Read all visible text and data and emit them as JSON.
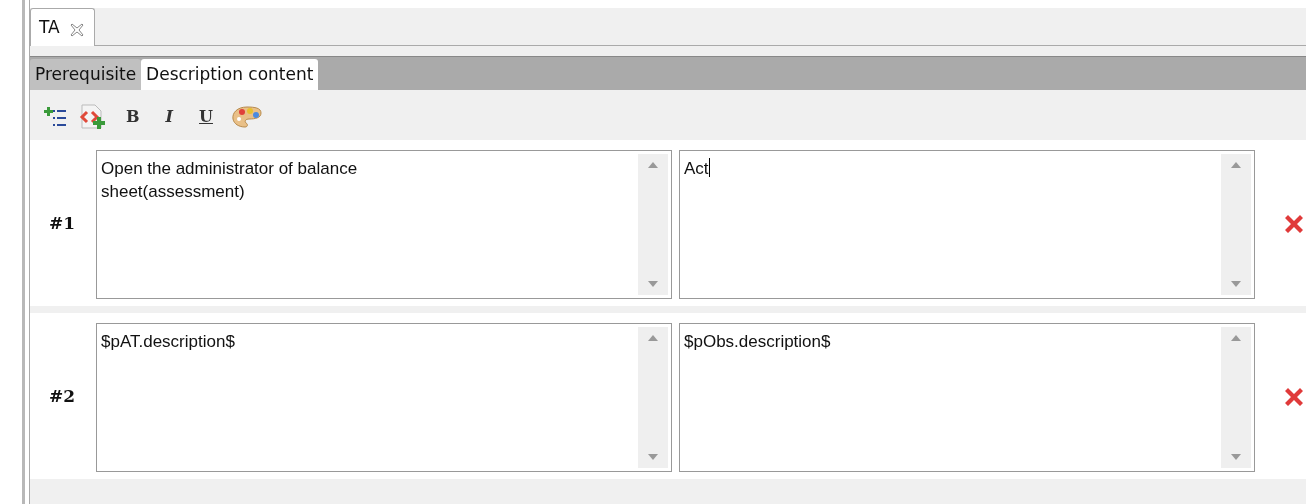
{
  "editor_tab": {
    "label": "TA",
    "closable": true
  },
  "tabs": [
    {
      "label": "Prerequisite",
      "selected": false
    },
    {
      "label": "Description content",
      "selected": true
    }
  ],
  "toolbar": [
    {
      "kind": "add-list"
    },
    {
      "kind": "add-code"
    },
    {
      "kind": "bold",
      "label": "B"
    },
    {
      "kind": "italic",
      "label": "I"
    },
    {
      "kind": "underline",
      "label": "U"
    },
    {
      "kind": "palette"
    }
  ],
  "rows": [
    {
      "label": "#1",
      "left": "Open the administrator of balance sheet(assessment)",
      "right": "Act",
      "right_caret": true
    },
    {
      "label": "#2",
      "left": "$pAT.description$",
      "right": "$pObs.description$",
      "right_caret": false
    }
  ]
}
